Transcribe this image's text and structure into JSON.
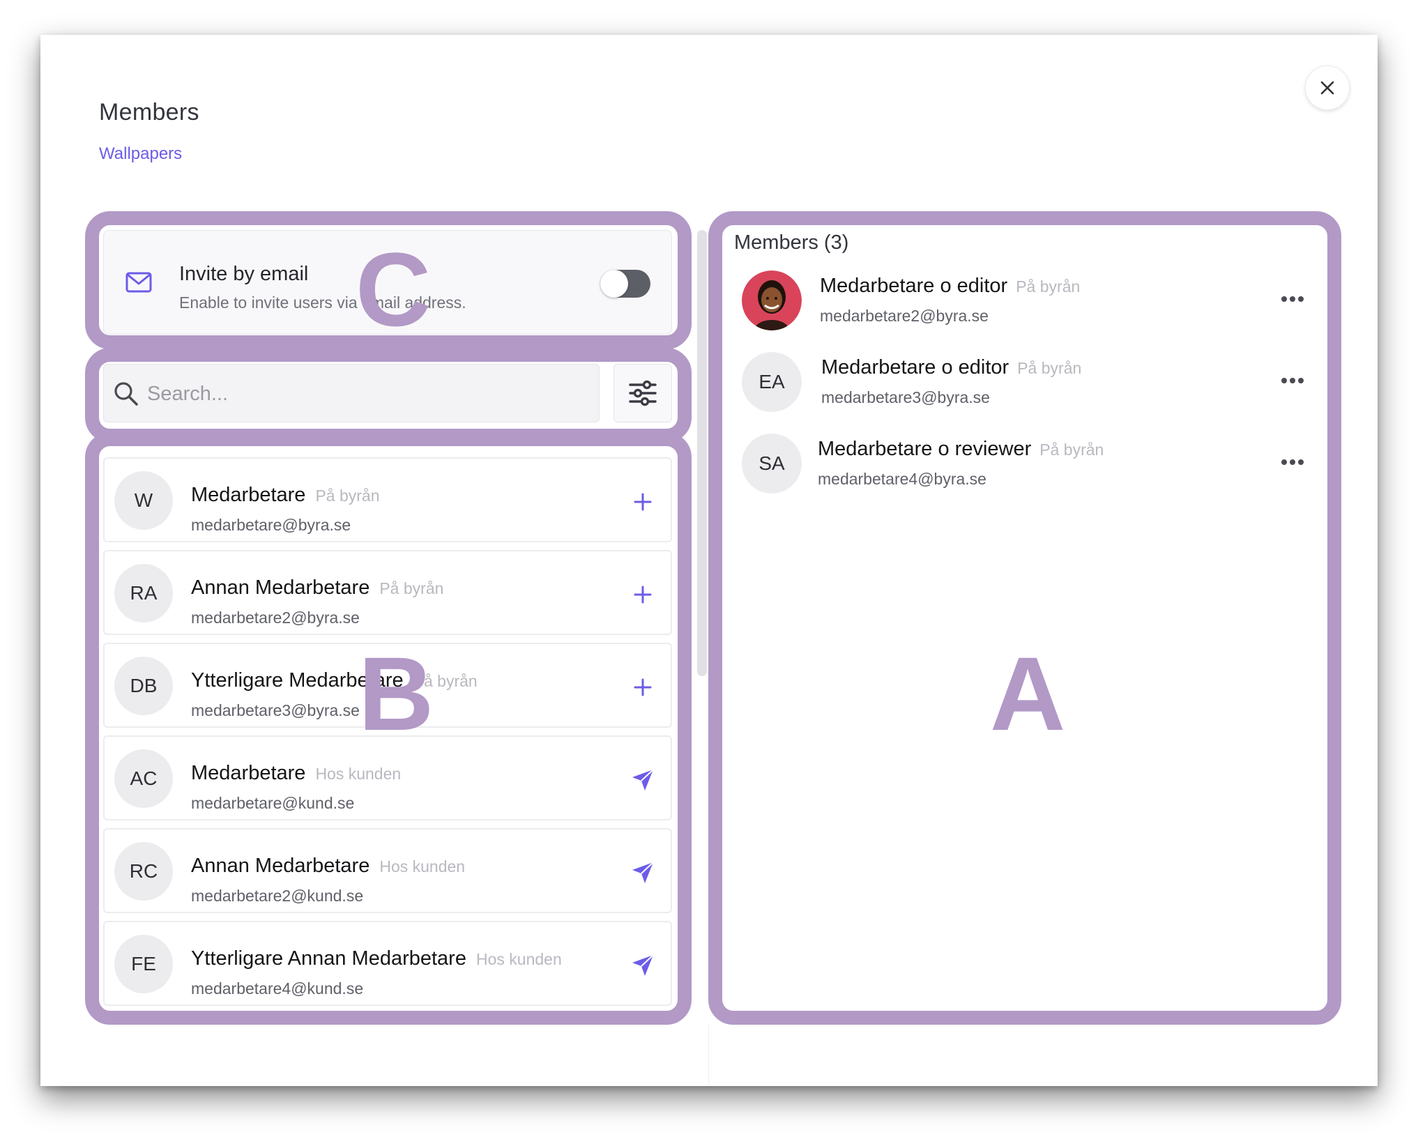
{
  "dialog": {
    "title": "Members",
    "subtitle": "Wallpapers"
  },
  "invite": {
    "title": "Invite by email",
    "description": "Enable to invite users via email address.",
    "toggle_on": false
  },
  "search": {
    "placeholder": "Search..."
  },
  "users": [
    {
      "initials": "W",
      "name": "Medarbetare",
      "tag": "På byrån",
      "email": "medarbetare@byra.se",
      "action": "add"
    },
    {
      "initials": "RA",
      "name": "Annan Medarbetare",
      "tag": "På byrån",
      "email": "medarbetare2@byra.se",
      "action": "add"
    },
    {
      "initials": "DB",
      "name": "Ytterligare Medarbetare",
      "tag": "På byrån",
      "email": "medarbetare3@byra.se",
      "action": "add"
    },
    {
      "initials": "AC",
      "name": "Medarbetare",
      "tag": "Hos kunden",
      "email": "medarbetare@kund.se",
      "action": "send"
    },
    {
      "initials": "RC",
      "name": "Annan Medarbetare",
      "tag": "Hos kunden",
      "email": "medarbetare2@kund.se",
      "action": "send"
    },
    {
      "initials": "FE",
      "name": "Ytterligare Annan Medarbetare",
      "tag": "Hos kunden",
      "email": "medarbetare4@kund.se",
      "action": "send"
    }
  ],
  "members_panel": {
    "heading": "Members (3)",
    "members": [
      {
        "initials": "",
        "photo": true,
        "name": "Medarbetare o editor",
        "tag": "På byrån",
        "email": "medarbetare2@byra.se"
      },
      {
        "initials": "EA",
        "photo": false,
        "name": "Medarbetare o editor",
        "tag": "På byrån",
        "email": "medarbetare3@byra.se"
      },
      {
        "initials": "SA",
        "photo": false,
        "name": "Medarbetare o reviewer",
        "tag": "På byrån",
        "email": "medarbetare4@byra.se"
      }
    ]
  },
  "overlay_labels": {
    "a": "A",
    "b": "B",
    "c": "C"
  },
  "colors": {
    "accent": "#6c5ce7",
    "overlay": "#b299c6"
  }
}
